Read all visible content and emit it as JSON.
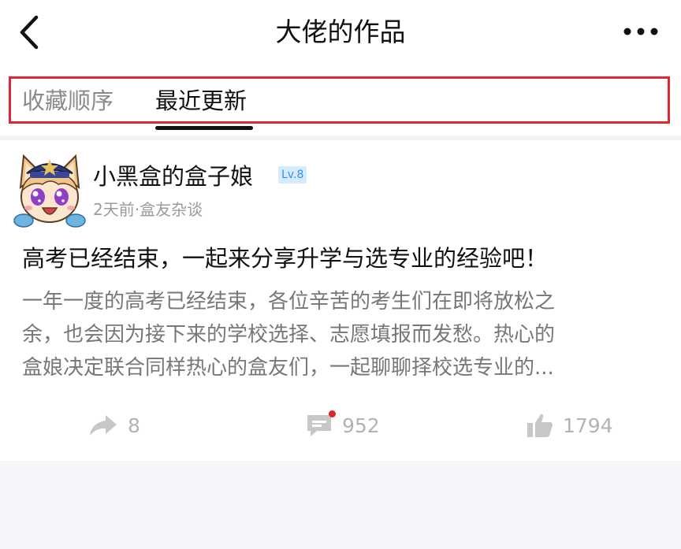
{
  "header": {
    "title": "大佬的作品",
    "back_icon": "chevron-left-icon",
    "more_icon": "more-horizontal-icon"
  },
  "tabs": [
    {
      "label": "收藏顺序",
      "active": false
    },
    {
      "label": "最近更新",
      "active": true
    }
  ],
  "post": {
    "author": {
      "name": "小黑盒的盒子娘",
      "level": "Lv.8",
      "avatar_icon": "cat-girl-avatar"
    },
    "meta": "2天前·盒友杂谈",
    "title": "高考已经结束，一起来分享升学与选专业的经验吧！",
    "excerpt_lines": [
      "一年一度的高考已经结束，各位辛苦的考生们在即将放松之",
      "余，也会因为接下来的学校选择、志愿填报而发愁。热心的",
      "盒娘决定联合同样热心的盒友们，一起聊聊择校选专业的..."
    ],
    "actions": {
      "share_count": "8",
      "comment_count": "952",
      "like_count": "1794",
      "comment_has_unread": true
    }
  },
  "colors": {
    "highlight_border": "#e02631",
    "level_badge_bg": "#d6ebff",
    "level_badge_text": "#3a8fe8",
    "unread_dot": "#e0222b"
  }
}
